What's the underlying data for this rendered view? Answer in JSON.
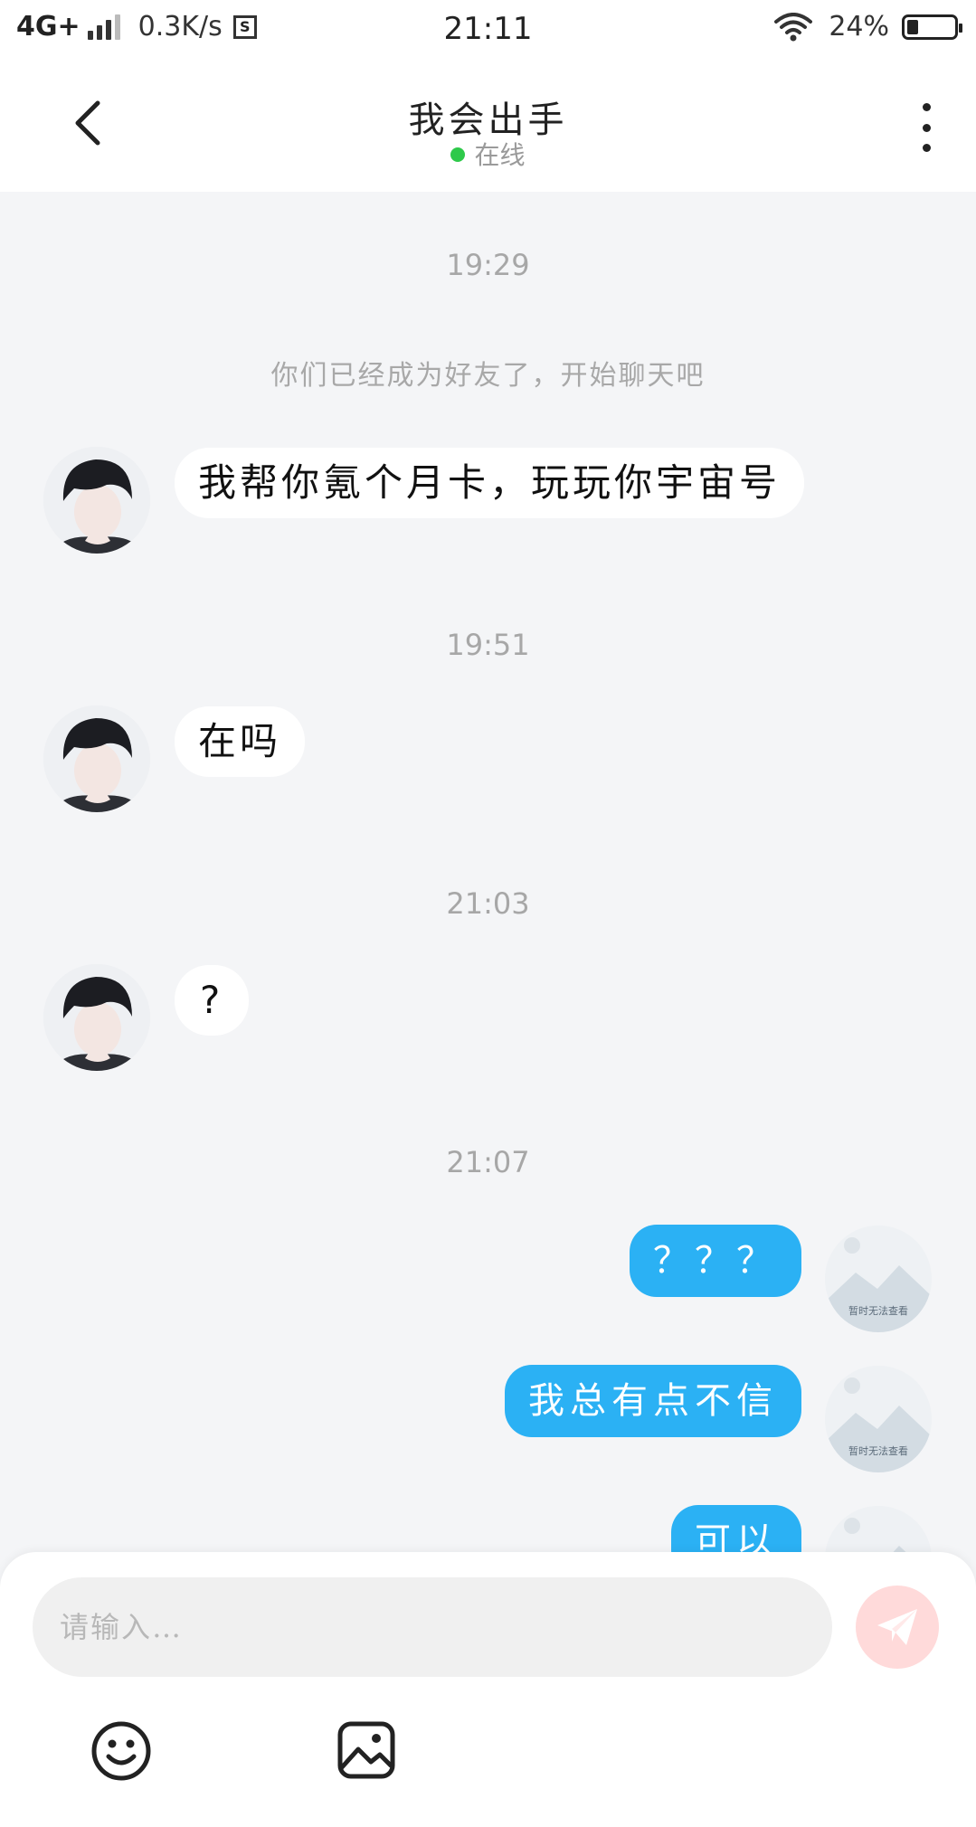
{
  "status_bar": {
    "network": "4G+",
    "speed": "0.3K/s",
    "time": "21:11",
    "battery": "24%",
    "battery_level": 0.24
  },
  "header": {
    "title": "我会出手",
    "status": "在线",
    "status_color": "#2ec94a"
  },
  "chat": {
    "timestamps": [
      "19:29",
      "19:51",
      "21:03",
      "21:07"
    ],
    "system_message": "你们已经成为好友了，开始聊天吧",
    "incoming": [
      {
        "text": "我帮你氪个月卡，玩玩你宇宙号"
      },
      {
        "text": "在吗"
      },
      {
        "text": "?"
      }
    ],
    "outgoing": [
      {
        "text": "？？？"
      },
      {
        "text": "我总有点不信"
      },
      {
        "text": "可以"
      }
    ],
    "outgoing_avatar_label": "暂时无法查看"
  },
  "input": {
    "placeholder": "请输入…"
  },
  "icons": {
    "back": "chevron-left-icon",
    "more": "more-vertical-icon",
    "send": "send-icon",
    "emoji": "emoji-icon",
    "image": "image-icon"
  },
  "colors": {
    "bubble_out": "#2bb1f4",
    "bubble_in": "#ffffff",
    "background": "#f4f5f7",
    "send_button": "#ffdada"
  }
}
